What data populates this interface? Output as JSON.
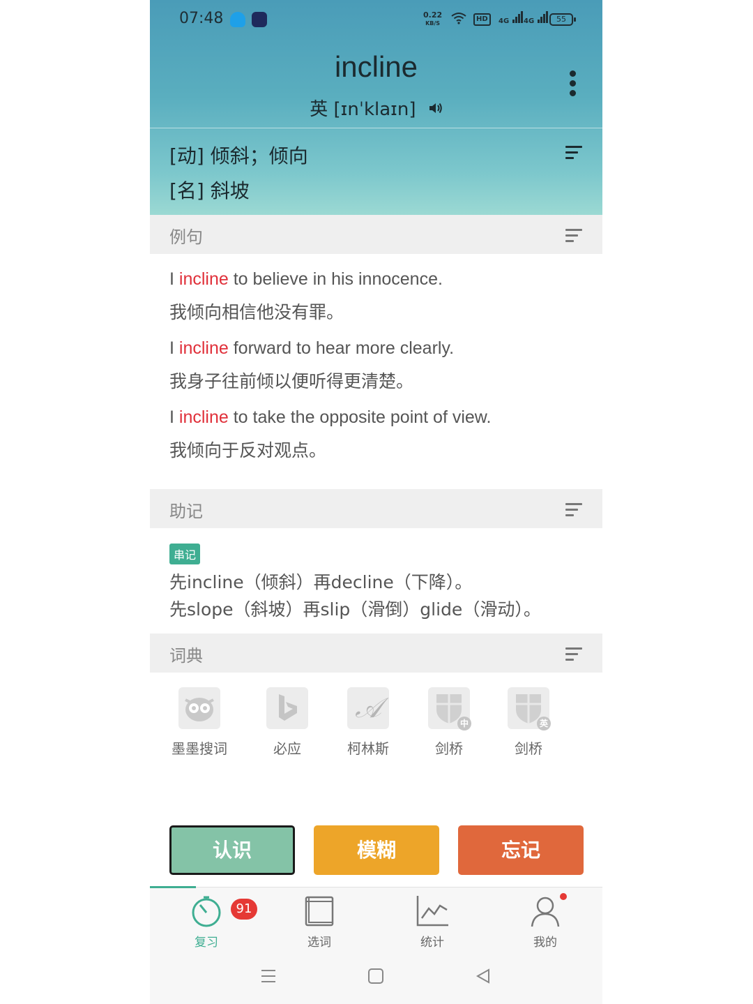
{
  "status_bar": {
    "time": "07:48",
    "net_speed_value": "0.22",
    "net_speed_unit": "KB/S",
    "hd": "HD",
    "signal_1": "4G",
    "signal_2": "4G",
    "battery": "55"
  },
  "word": {
    "headword": "incline",
    "phonetic": "英 [ɪnˈklaɪn]",
    "definitions": [
      "[动] 倾斜；倾向",
      "[名] 斜坡"
    ]
  },
  "examples": {
    "title": "例句",
    "items": [
      {
        "before": "I ",
        "highlight": "incline",
        "after": " to believe in his innocence.",
        "zh": "我倾向相信他没有罪。"
      },
      {
        "before": "I ",
        "highlight": "incline",
        "after": " forward to hear more clearly.",
        "zh": "我身子往前倾以便听得更清楚。"
      },
      {
        "before": "I ",
        "highlight": "incline",
        "after": " to take the opposite point of view.",
        "zh": "我倾向于反对观点。"
      }
    ]
  },
  "mnemonic": {
    "title": "助记",
    "tag": "串记",
    "lines": [
      "先incline（倾斜）再decline（下降）。",
      "先slope（斜坡）再slip（滑倒）glide（滑动）。"
    ]
  },
  "dictionaries": {
    "title": "词典",
    "items": [
      {
        "label": "墨墨搜词",
        "icon": "owl-icon"
      },
      {
        "label": "必应",
        "icon": "bing-icon"
      },
      {
        "label": "柯林斯",
        "icon": "collins-icon"
      },
      {
        "label": "剑桥",
        "icon": "cambridge-icon",
        "sub": "中"
      },
      {
        "label": "剑桥",
        "icon": "cambridge-icon",
        "sub": "英"
      }
    ]
  },
  "actions": {
    "know": "认识",
    "fuzzy": "模糊",
    "forget": "忘记"
  },
  "tabs": {
    "review": "复习",
    "review_badge": "91",
    "select": "选词",
    "stats": "统计",
    "mine": "我的"
  },
  "colors": {
    "accent": "#3fae92",
    "know": "#84c3a7",
    "fuzzy": "#eda529",
    "forget": "#e0683c",
    "highlight": "#e0303a"
  }
}
